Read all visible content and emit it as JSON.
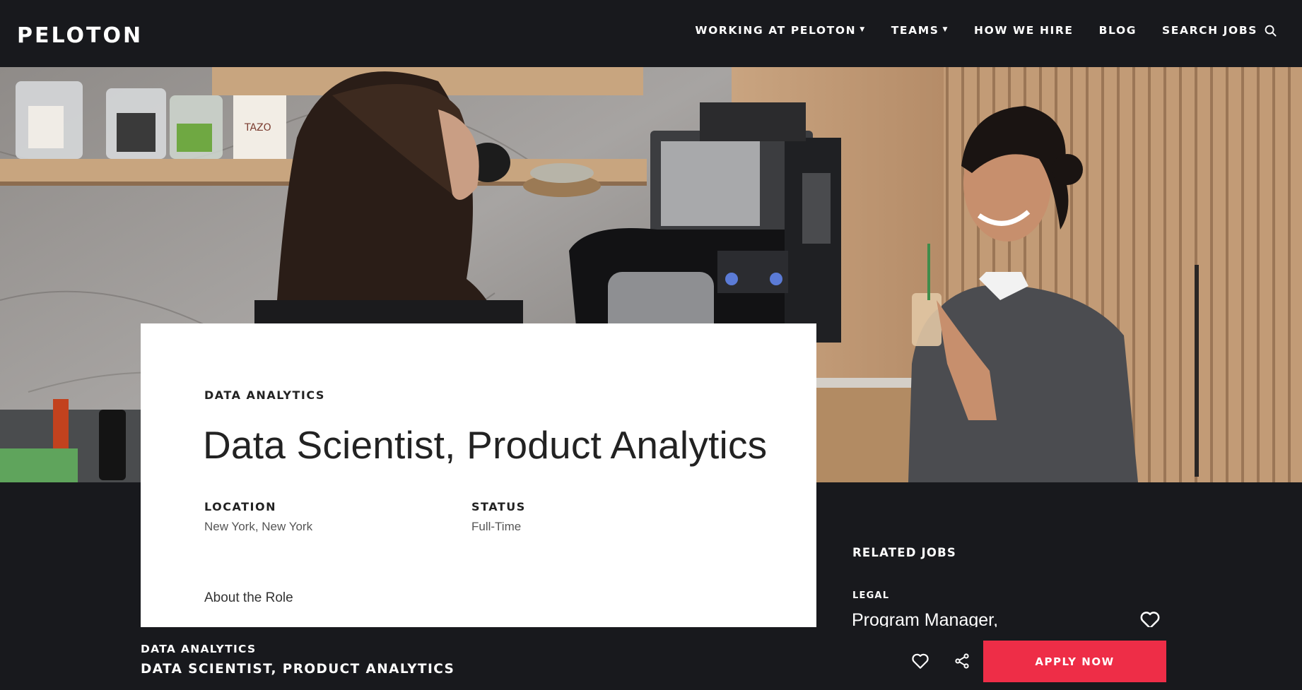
{
  "nav": {
    "logo": "PELOTON",
    "links": [
      {
        "label": "WORKING AT PELOTON",
        "has_caret": true
      },
      {
        "label": "TEAMS",
        "has_caret": true
      },
      {
        "label": "HOW WE HIRE",
        "has_caret": false
      },
      {
        "label": "BLOG",
        "has_caret": false
      },
      {
        "label": "SEARCH JOBS",
        "has_caret": false,
        "icon": "search-icon"
      }
    ]
  },
  "job": {
    "category": "DATA ANALYTICS",
    "title": "Data Scientist, Product Analytics",
    "location_label": "LOCATION",
    "location_value": "New York, New York",
    "status_label": "STATUS",
    "status_value": "Full-Time",
    "about_heading": "About the Role"
  },
  "related": {
    "heading": "RELATED JOBS",
    "items": [
      {
        "category": "LEGAL",
        "title": "Program Manager,"
      }
    ]
  },
  "bottom_bar": {
    "category": "DATA ANALYTICS",
    "title": "DATA SCIENTIST, PRODUCT ANALYTICS",
    "apply_label": "APPLY NOW"
  },
  "colors": {
    "background": "#18191d",
    "accent": "#ee2d47",
    "card": "#ffffff"
  }
}
